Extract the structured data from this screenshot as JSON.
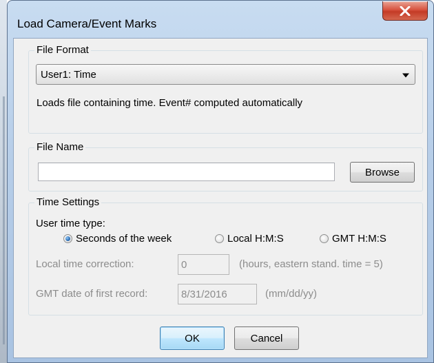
{
  "window": {
    "title": "Load Camera/Event Marks",
    "close_symbol": "×"
  },
  "file_format": {
    "group_label": "File Format",
    "selected": "User1: Time",
    "description": "Loads file containing time. Event# computed automatically"
  },
  "file_name": {
    "group_label": "File Name",
    "value": "",
    "browse_label": "Browse"
  },
  "time_settings": {
    "group_label": "Time Settings",
    "user_time_type_label": "User time type:",
    "options": [
      {
        "label": "Seconds of the week",
        "checked": true
      },
      {
        "label": "Local H:M:S",
        "checked": false
      },
      {
        "label": "GMT H:M:S",
        "checked": false
      }
    ],
    "local_correction_label": "Local time correction:",
    "local_correction_value": "0",
    "local_correction_hint": "(hours, eastern stand. time = 5)",
    "gmt_date_label": "GMT date of first record:",
    "gmt_date_value": "8/31/2016",
    "gmt_date_hint": "(mm/dd/yy)"
  },
  "buttons": {
    "ok_label": "OK",
    "cancel_label": "Cancel"
  },
  "icons": {
    "close": "close-icon",
    "dropdown": "chevron-down-icon",
    "radio": "radio-icon"
  },
  "colors": {
    "frame": "#b6cde8",
    "close_button": "#d8533f",
    "default_button_border": "#3c7fb1",
    "disabled_text": "#8c8c8c"
  }
}
